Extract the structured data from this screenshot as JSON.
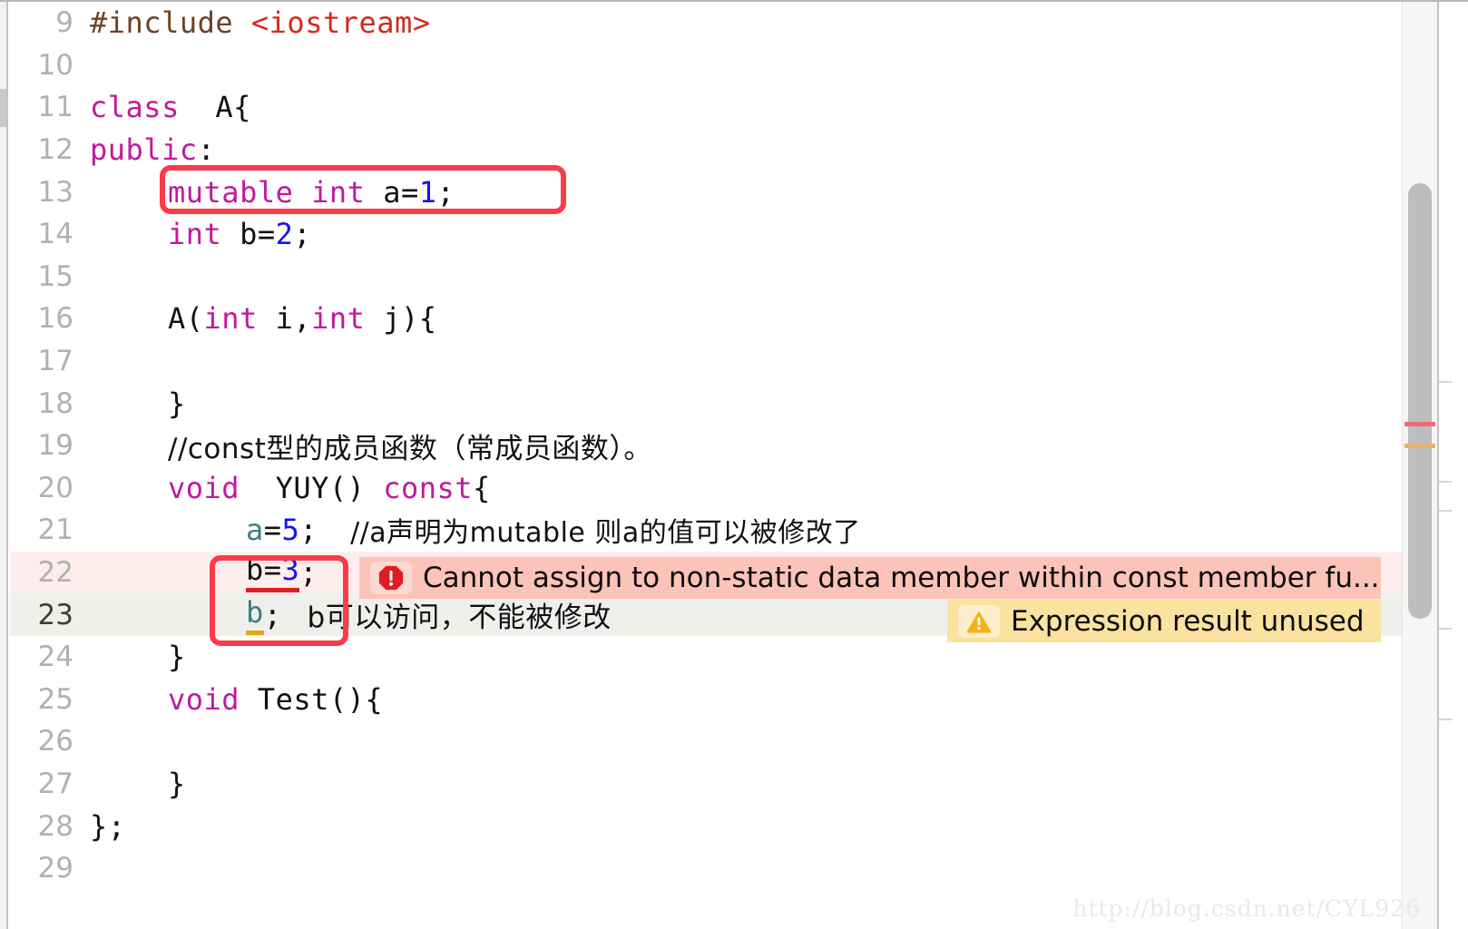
{
  "editor": {
    "first_visible_line": 9,
    "current_line": 23,
    "watermark": "http://blog.csdn.net/CYL926",
    "colors": {
      "keyword": "#c1199e",
      "number": "#1414f0",
      "string": "#d12b1e",
      "preprocessor": "#6b4226",
      "comment": "#1a8f2a",
      "identifier": "#3f7e83",
      "error_row_bg": "#fdeeed",
      "current_row_bg": "#eff0ec",
      "error_banner_bg": "#fcc3b8",
      "warning_banner_bg": "#fae2a0",
      "annotation_box": "#fb3b4a",
      "error_underline": "#e02020",
      "warning_underline": "#e8a317"
    }
  },
  "lines": [
    {
      "num": "9",
      "indent": 0
    },
    {
      "num": "10",
      "indent": 0
    },
    {
      "num": "11",
      "indent": 0
    },
    {
      "num": "12",
      "indent": 0
    },
    {
      "num": "13",
      "indent": 0
    },
    {
      "num": "14",
      "indent": 0
    },
    {
      "num": "15",
      "indent": 0
    },
    {
      "num": "16",
      "indent": 0
    },
    {
      "num": "17",
      "indent": 0
    },
    {
      "num": "18",
      "indent": 0
    },
    {
      "num": "19",
      "indent": 0
    },
    {
      "num": "20",
      "indent": 0
    },
    {
      "num": "21",
      "indent": 0
    },
    {
      "num": "22",
      "indent": 0
    },
    {
      "num": "23",
      "indent": 0
    },
    {
      "num": "24",
      "indent": 0
    },
    {
      "num": "25",
      "indent": 0
    },
    {
      "num": "26",
      "indent": 0
    },
    {
      "num": "27",
      "indent": 0
    },
    {
      "num": "28",
      "indent": 0
    },
    {
      "num": "29",
      "indent": 0
    }
  ],
  "code": {
    "l9_include": "#include ",
    "l9_header": "<iostream>",
    "l11_kw": "class",
    "l11_rest": "  A{",
    "l12_kw": "public",
    "l12_rest": ":",
    "l13_kw1": "mutable",
    "l13_sp1": " ",
    "l13_kw2": "int",
    "l13_rest": " a=",
    "l13_num": "1",
    "l13_end": ";",
    "l14_kw": "int",
    "l14_rest": " b=",
    "l14_num": "2",
    "l14_end": ";",
    "l16_a": "A(",
    "l16_kw1": "int",
    "l16_mid": " i,",
    "l16_kw2": "int",
    "l16_end": " j){",
    "l18_brace": "}",
    "l19_comment": "//const型的成员函数（常成员函数）。",
    "l20_kw1": "void",
    "l20_mid": "  YUY() ",
    "l20_kw2": "const",
    "l20_end": "{",
    "l21_ident": "a",
    "l21_eq": "=",
    "l21_num": "5",
    "l21_end": ";",
    "l21_comment": "//a声明为mutable 则a的值可以被修改了",
    "l22_ident": "b",
    "l22_eq": "=",
    "l22_num": "3",
    "l22_end": ";",
    "l23_ident": "b",
    "l23_end": ";",
    "l23_comment": "b可以访问，不能被修改",
    "l24_brace": "}",
    "l25_kw": "void",
    "l25_rest": " Test(){",
    "l27_brace": "}",
    "l28_end": "};"
  },
  "diagnostics": {
    "error": {
      "icon": "error-octagon-icon",
      "line": "22",
      "message": "Cannot assign to non-static data member within const member fu..."
    },
    "warning": {
      "icon": "warning-triangle-icon",
      "line": "23",
      "message": "Expression result unused"
    }
  },
  "annotations": {
    "box_mutable_label": "mutable-declaration-highlight",
    "box_b_label": "b-usage-highlight"
  }
}
